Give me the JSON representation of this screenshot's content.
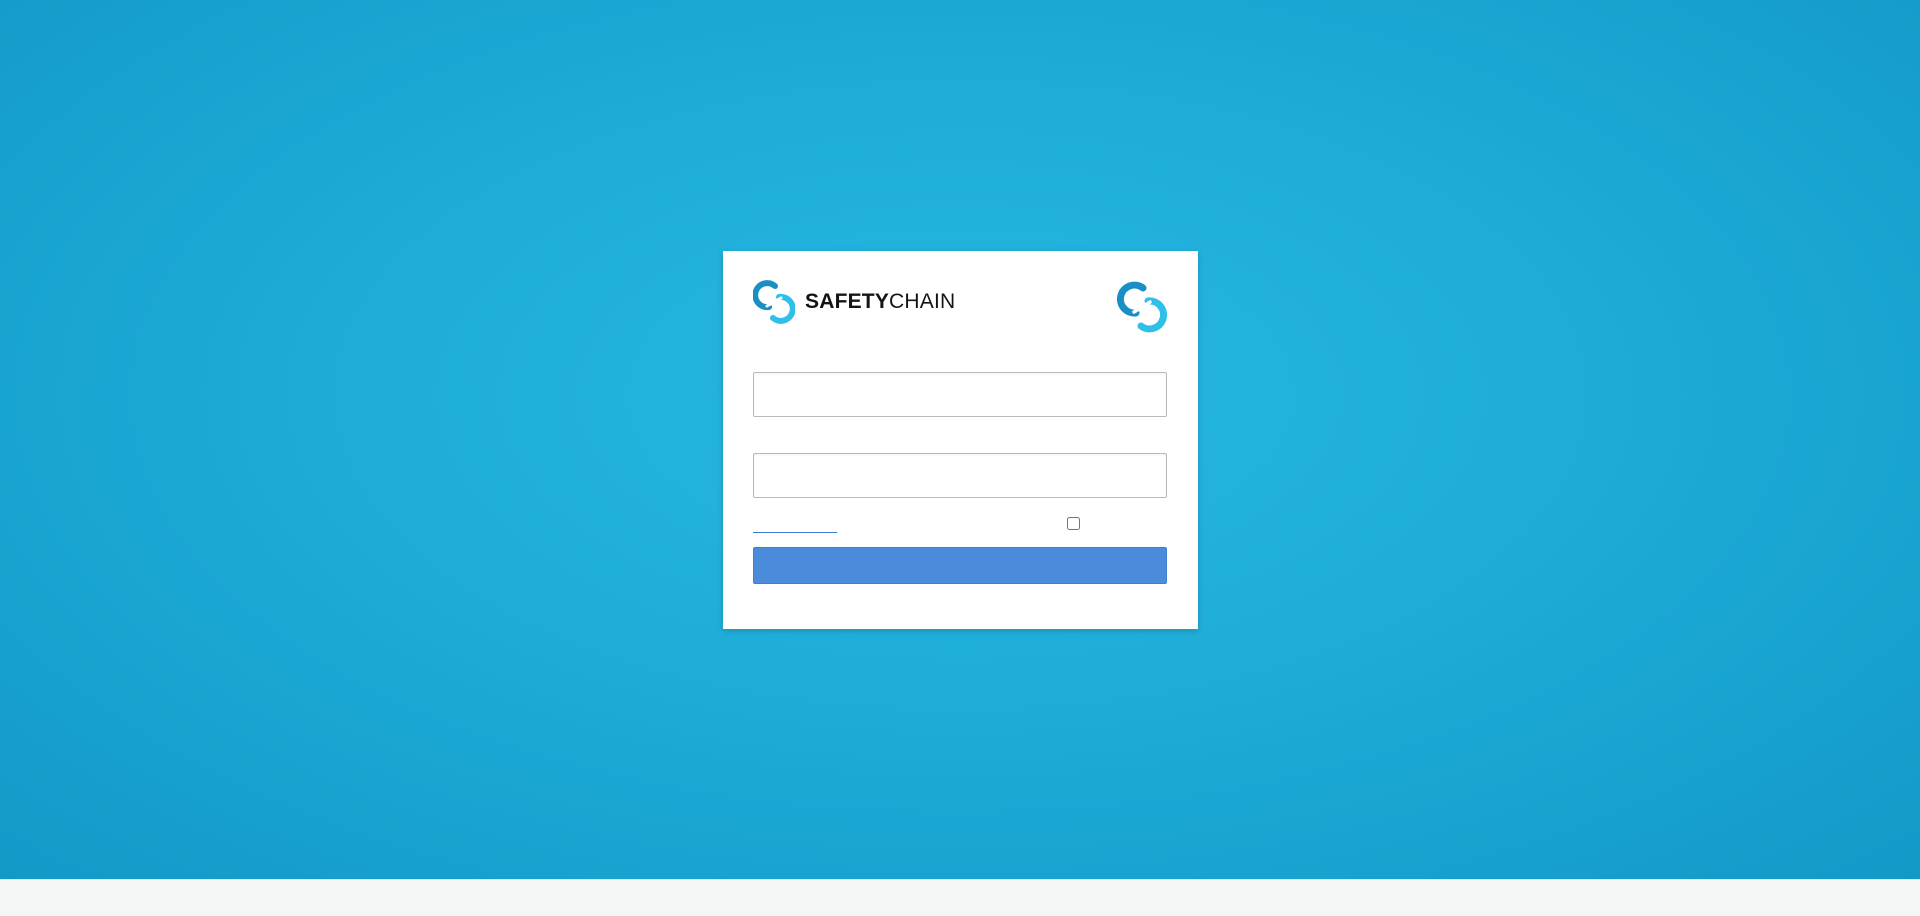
{
  "brand": {
    "name_bold": "SAFETY",
    "name_light": "CHAIN",
    "logo_icon": "safetychain-link-icon",
    "corner_icon": "safetychain-link-icon",
    "colors": {
      "dark_blue": "#1a8fc4",
      "light_blue": "#2ec0e8",
      "wordmark": "#141414"
    }
  },
  "login": {
    "username_value": "",
    "username_placeholder": "",
    "password_value": "",
    "password_placeholder": "",
    "forgot_link_label": "",
    "remember_label": "",
    "remember_checked": false,
    "submit_label": ""
  },
  "theme": {
    "background": "#20aed9",
    "button": "#4a8bdc",
    "link": "#3e7bd6",
    "footer": "#f4f6f5"
  },
  "footer": {
    "text": ""
  }
}
